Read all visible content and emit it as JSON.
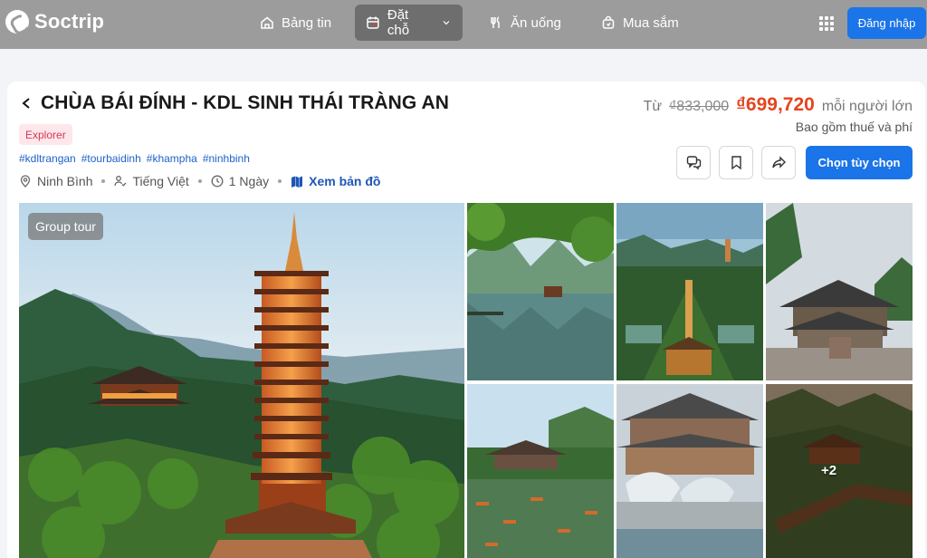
{
  "brand": {
    "name": "Soctrip"
  },
  "nav": {
    "items": [
      {
        "label": "Bảng tin",
        "icon": "home-icon"
      },
      {
        "label": "Đặt chỗ",
        "icon": "booking-icon"
      },
      {
        "label": "Ăn uống",
        "icon": "food-icon"
      },
      {
        "label": "Mua sắm",
        "icon": "shopping-bag-icon"
      }
    ],
    "login": "Đăng nhập"
  },
  "tour": {
    "title": "CHÙA BÁI ĐÍNH - KDL SINH THÁI TRÀNG AN",
    "badge": "Explorer",
    "tags": [
      "#kdltrangan",
      "#tourbaidinh",
      "#khampha",
      "#ninhbinh"
    ],
    "location": "Ninh Bình",
    "language": "Tiếng Việt",
    "duration": "1 Ngày",
    "map_link": "Xem bản đồ"
  },
  "price": {
    "from_label": "Từ",
    "original": "₫833,000",
    "current": "₫699,720",
    "unit": "mỗi người lớn",
    "note": "Bao gồm thuế và phí"
  },
  "actions": {
    "choose": "Chọn tùy chọn"
  },
  "gallery": {
    "tag": "Group tour",
    "more": "+2"
  },
  "colors": {
    "nav_bg": "#9c9c9c",
    "primary": "#1b74e8",
    "price": "#e4451f",
    "tag_link": "#1f62c9"
  }
}
